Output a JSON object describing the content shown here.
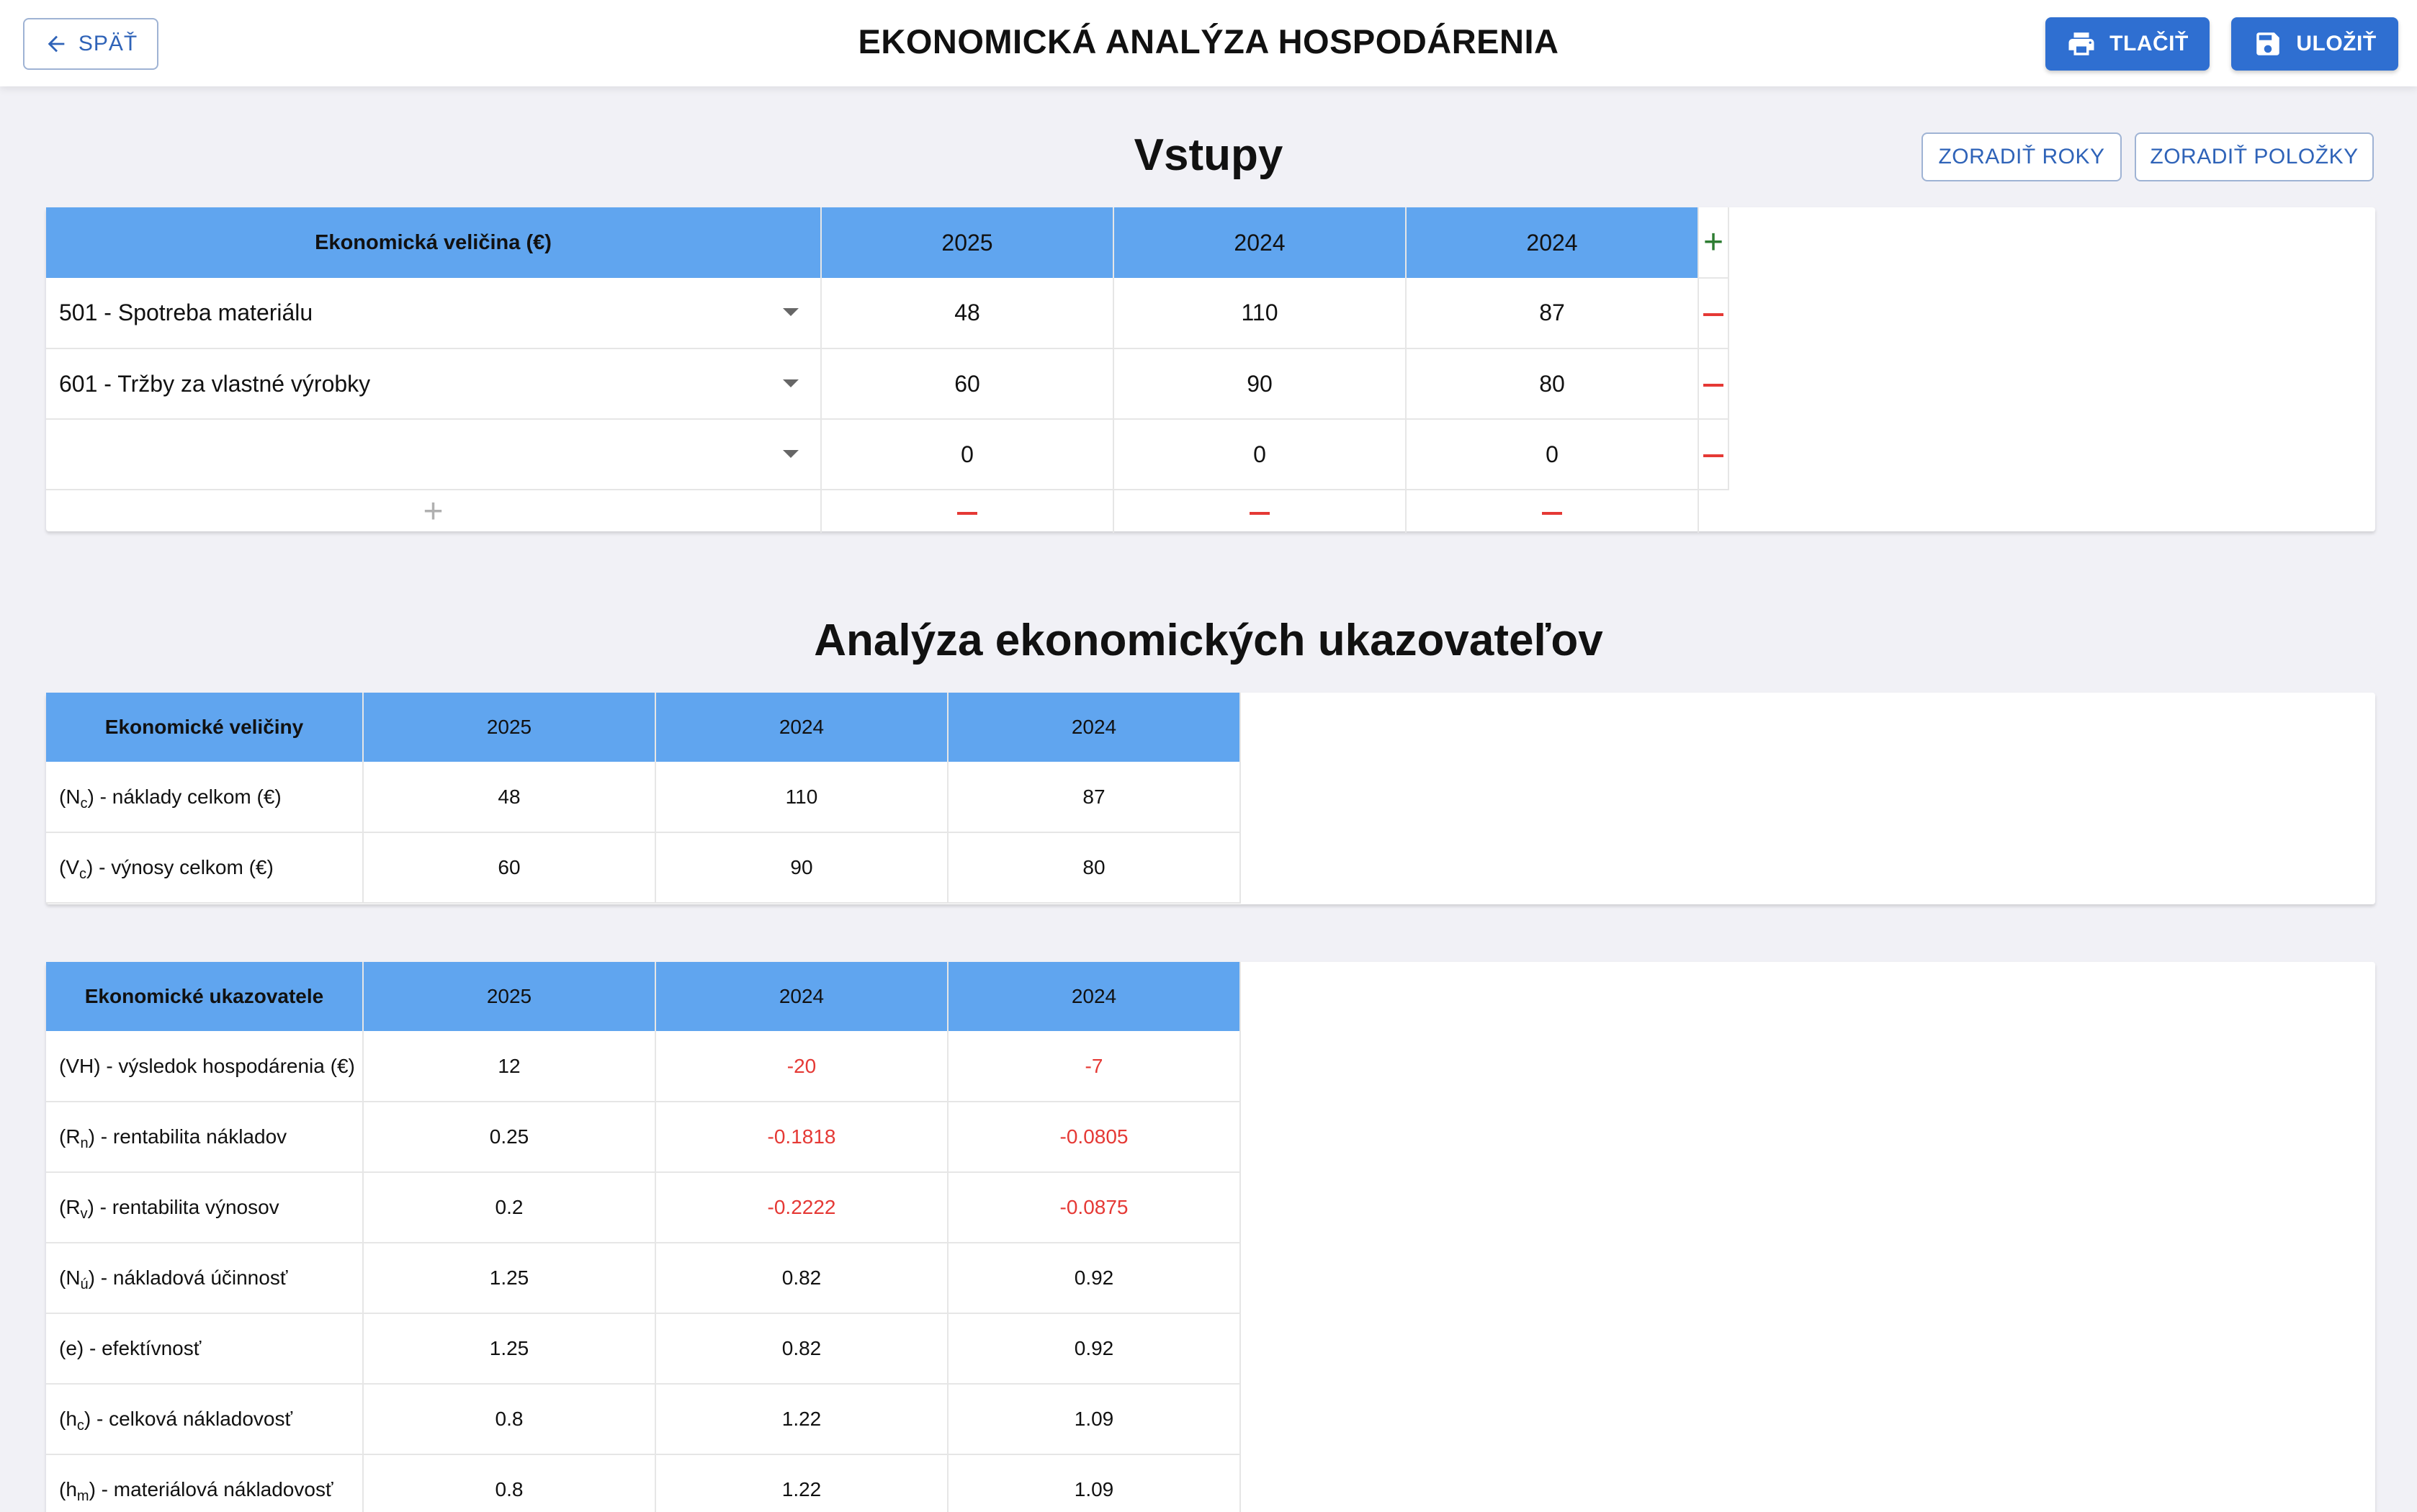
{
  "header": {
    "back_label": "SPÄŤ",
    "title": "EKONOMICKÁ ANALÝZA HOSPODÁRENIA",
    "print_label": "TLAČIŤ",
    "save_label": "ULOŽIŤ"
  },
  "inputs": {
    "title": "Vstupy",
    "sort_years_label": "ZORADIŤ ROKY",
    "sort_items_label": "ZORADIŤ POLOŽKY",
    "header": [
      "Ekonomická veličina (€)",
      "2025",
      "2024",
      "2024"
    ],
    "rows": [
      {
        "label": "501 - Spotreba materiálu",
        "values": [
          "48",
          "110",
          "87"
        ]
      },
      {
        "label": "601 - Tržby za vlastné výrobky",
        "values": [
          "60",
          "90",
          "80"
        ]
      },
      {
        "label": "",
        "values": [
          "0",
          "0",
          "0"
        ]
      }
    ]
  },
  "analysis": {
    "title": "Analýza ekonomických ukazovateľov",
    "quantities": {
      "header": [
        "Ekonomické veličiny",
        "2025",
        "2024",
        "2024"
      ],
      "rows": [
        {
          "prefix": "(N",
          "sub": "c",
          "suffix": ") - náklady celkom (€)",
          "values": [
            "48",
            "110",
            "87"
          ]
        },
        {
          "prefix": "(V",
          "sub": "c",
          "suffix": ") - výnosy celkom (€)",
          "values": [
            "60",
            "90",
            "80"
          ]
        }
      ]
    },
    "indicators": {
      "header": [
        "Ekonomické ukazovatele",
        "2025",
        "2024",
        "2024"
      ],
      "rows": [
        {
          "prefix": "(VH) - výsledok hospodárenia (€)",
          "sub": "",
          "suffix": "",
          "values": [
            "12",
            "-20",
            "-7"
          ]
        },
        {
          "prefix": "(R",
          "sub": "n",
          "suffix": ") - rentabilita nákladov",
          "values": [
            "0.25",
            "-0.1818",
            "-0.0805"
          ]
        },
        {
          "prefix": "(R",
          "sub": "v",
          "suffix": ") - rentabilita výnosov",
          "values": [
            "0.2",
            "-0.2222",
            "-0.0875"
          ]
        },
        {
          "prefix": "(N",
          "sub": "ú",
          "suffix": ") - nákladová účinnosť",
          "values": [
            "1.25",
            "0.82",
            "0.92"
          ]
        },
        {
          "prefix": "(e) - efektívnosť",
          "sub": "",
          "suffix": "",
          "values": [
            "1.25",
            "0.82",
            "0.92"
          ]
        },
        {
          "prefix": "(h",
          "sub": "c",
          "suffix": ") - celková nákladovosť",
          "values": [
            "0.8",
            "1.22",
            "1.09"
          ]
        },
        {
          "prefix": "(h",
          "sub": "m",
          "suffix": ") - materiálová nákladovosť",
          "values": [
            "0.8",
            "1.22",
            "1.09"
          ]
        }
      ]
    }
  },
  "colors": {
    "table_header": "#60a5ef",
    "primary_button": "#2f6fd1",
    "negative": "#e53935",
    "add": "#2e7d32"
  }
}
